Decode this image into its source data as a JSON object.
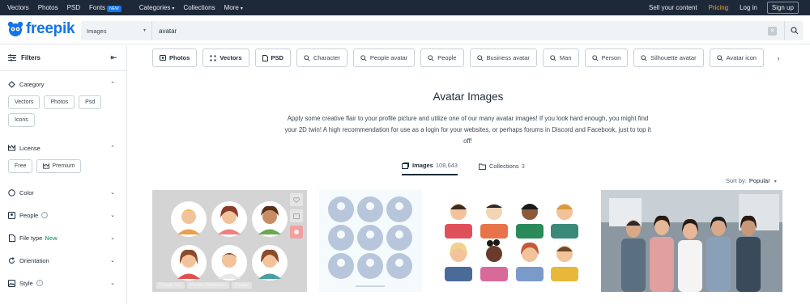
{
  "topbar": {
    "nav": [
      "Vectors",
      "Photos",
      "PSD",
      "Fonts",
      "Categories",
      "Collections",
      "More"
    ],
    "fonts_badge": "NEW",
    "sell": "Sell your content",
    "pricing": "Pricing",
    "login": "Log in",
    "signup": "Sign up"
  },
  "brand": {
    "name": "freepik",
    "color": "#1273eb"
  },
  "search": {
    "type": "Images",
    "value": "avatar"
  },
  "sidebar": {
    "filters_label": "Filters",
    "category": {
      "label": "Category",
      "chips": [
        "Vectors",
        "Photos",
        "Psd",
        "Icons"
      ]
    },
    "license": {
      "label": "License",
      "chips": [
        "Free",
        "Premium"
      ]
    },
    "color": "Color",
    "people": "People",
    "file_type": "File type",
    "file_type_new": "New",
    "orientation": "Orientation",
    "style": "Style"
  },
  "tags": [
    "Photos",
    "Vectors",
    "PSD",
    "Character",
    "People avatar",
    "People",
    "Business avatar",
    "Man",
    "Person",
    "Silhouette avatar",
    "Avatar icon"
  ],
  "hero": {
    "title": "Avatar Images",
    "description": "Apply some creative flair to your profile picture and utilize one of our many avatar images! If you look hard enough, you might find your 2D twin! A high recommendation for use as a login for your websites, or perhaps forums in Discord and Facebook, just to top it off!"
  },
  "tabs": {
    "images_label": "Images",
    "images_count": "108,643",
    "collections_label": "Collections",
    "collections_count": "3"
  },
  "sort": {
    "label": "Sort by:",
    "value": "Popular"
  },
  "cards": {
    "c1_tags": [
      "People Set",
      "Person Illustration",
      "People"
    ]
  }
}
